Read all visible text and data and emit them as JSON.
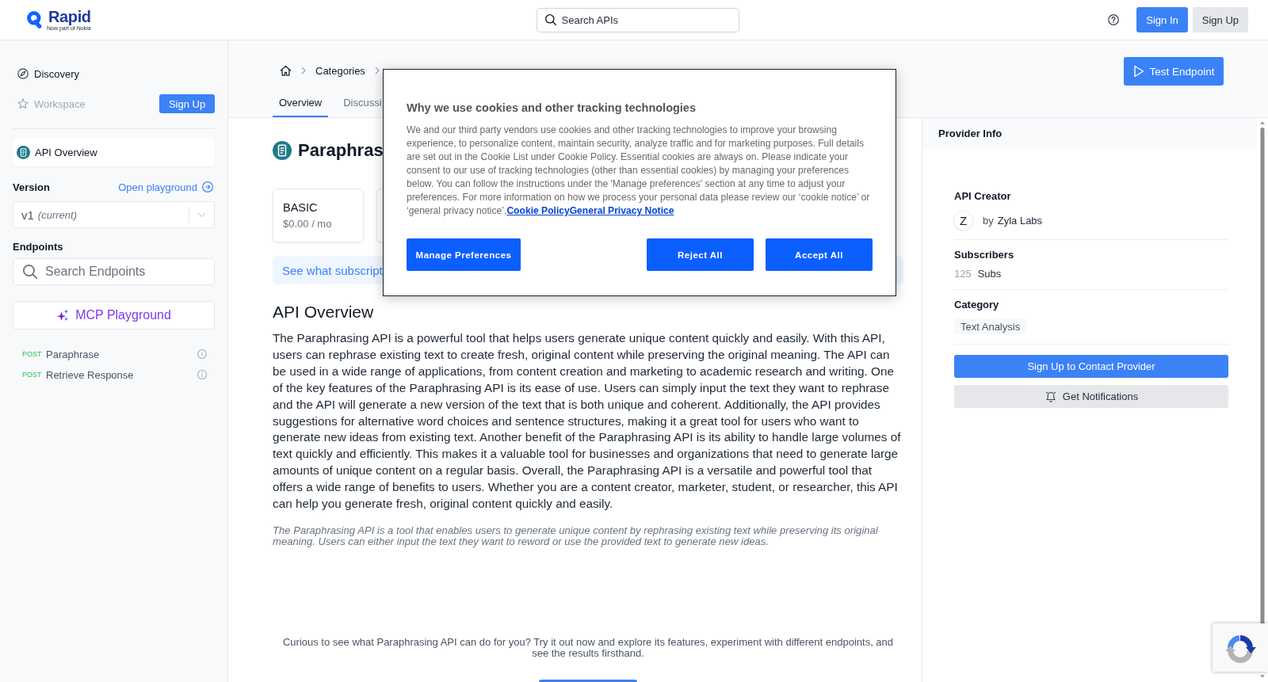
{
  "header": {
    "logo": {
      "name": "Rapid",
      "tagline": "Now part of Nokia"
    },
    "search": {
      "placeholder": "Search APIs"
    },
    "buttons": [
      {
        "label": "Sign In",
        "kind": "primary"
      },
      {
        "label": "Sign Up",
        "kind": "secondary"
      }
    ]
  },
  "sidebar": {
    "nav": [
      {
        "label": "Discovery",
        "disabled": false
      },
      {
        "label": "Workspace",
        "disabled": true,
        "action": "Sign Up"
      }
    ],
    "api_item": {
      "label": "API Overview",
      "selected": true
    },
    "version": {
      "label": "Version",
      "link": "Open playground",
      "value": "v1",
      "note": "(current)"
    },
    "endpoints": {
      "label": "Endpoints",
      "search": {
        "placeholder": "Search Endpoints"
      },
      "mcp_button": "MCP Playground",
      "items": [
        {
          "method": "POST",
          "name": "Paraphrase"
        },
        {
          "method": "POST",
          "name": "Retrieve Response"
        }
      ]
    }
  },
  "breadcrumb": [
    {
      "label": "Categories",
      "kind": "link"
    },
    {
      "kind": "covered"
    }
  ],
  "tabs": [
    {
      "label": "Overview",
      "selected": true
    },
    {
      "label": "Discussi",
      "selected": false
    }
  ],
  "test_button": "Test Endpoint",
  "api": {
    "title": "Paraphras",
    "plans": [
      {
        "kind": "shown",
        "name": "BASIC",
        "price": "$0.00 / mo"
      },
      {
        "kind": "covered"
      }
    ],
    "banner": "See what subscript",
    "overview": {
      "heading": "API Overview",
      "body": "The Paraphrasing API is a powerful tool that helps users generate unique content quickly and easily. With this API, users can rephrase existing text to create fresh, original content while preserving the original meaning. The API can be used in a wide range of applications, from content creation and marketing to academic research and writing. One of the key features of the Paraphrasing API is its ease of use. Users can simply input the text they want to rephrase and the API will generate a new version of the text that is both unique and coherent. Additionally, the API provides suggestions for alternative word choices and sentence structures, making it a great tool for users who want to generate new ideas from existing text. Another benefit of the Paraphrasing API is its ability to handle large volumes of text quickly and efficiently. This makes it a valuable tool for businesses and organizations that need to generate large amounts of unique content on a regular basis. Overall, the Paraphrasing API is a versatile and powerful tool that offers a wide range of benefits to users. Whether you are a content creator, marketer, student, or researcher, this API can help you generate fresh, original content quickly and easily.",
      "summary": "The Paraphrasing API is a tool that enables users to generate unique content by rephrasing existing text while preserving its original meaning. Users can either input the text they want to reword or use the provided text to generate new ideas."
    },
    "cta": {
      "text": "Curious to see what Paraphrasing API can do for you? Try it out now and explore its features, experiment with different endpoints, and see the results firsthand."
    }
  },
  "provider": {
    "title": "Provider Info",
    "creator": {
      "label": "API Creator",
      "initial": "Z",
      "prefix": "by",
      "name": "Zyla Labs"
    },
    "subscribers": {
      "label": "Subscribers",
      "count": "125",
      "unit": "Subs"
    },
    "category": {
      "label": "Category",
      "tag": "Text Analysis"
    },
    "buttons": [
      {
        "label": "Sign Up to Contact Provider",
        "kind": "primary"
      },
      {
        "label": "Get Notifications",
        "kind": "notify"
      }
    ]
  },
  "cookie_dialog": {
    "title": "Why we use cookies and other tracking technologies",
    "body": "We and our third party vendors use cookies and other tracking technologies to improve your browsing experience, to personalize content, maintain security, analyze traffic and for marketing purposes. Full details are set out in the Cookie List under Cookie Policy. Essential cookies are always on. Please indicate your consent to our use of tracking technologies (other than essential cookies) by managing your preferences below. You can follow the instructions under the 'Manage preferences' section at any time to adjust your preferences. For more information on how we process your personal data please review our ‘cookie notice’ or ‘general privacy notice’.",
    "links": [
      "Cookie Policy",
      "General Privacy Notice"
    ],
    "buttons": [
      {
        "label": "Manage Preferences"
      },
      {
        "label": "Reject All"
      },
      {
        "label": "Accept All"
      }
    ]
  }
}
